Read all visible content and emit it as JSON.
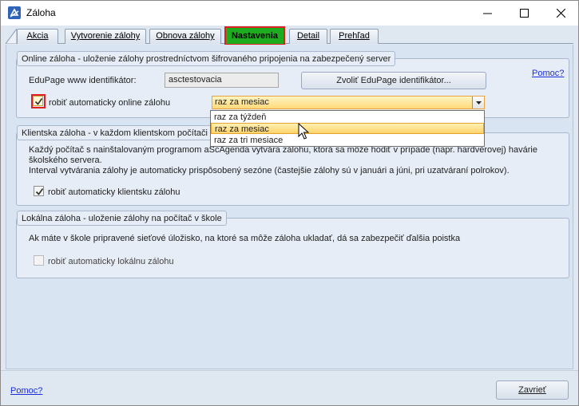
{
  "window": {
    "title": "Záloha",
    "controls": {
      "minimize": "minimize",
      "maximize": "maximize",
      "close": "close"
    }
  },
  "tabs": [
    {
      "label": "Akcia",
      "active": false
    },
    {
      "label": "Vytvorenie zálohy",
      "active": false
    },
    {
      "label": "Obnova zálohy",
      "active": false
    },
    {
      "label": "Nastavenia",
      "active": true
    },
    {
      "label": "Detail",
      "active": false
    },
    {
      "label": "Prehľad",
      "active": false
    }
  ],
  "online_group": {
    "title": "Online záloha - uloženie zálohy prostredníctvom šifrovaného pripojenia na zabezpečený server",
    "identifier_label": "EduPage www identifikátor:",
    "identifier_value": "asctestovacia",
    "choose_button": "Zvoliť EduPage identifikátor...",
    "help_link": "Pomoc?",
    "auto_checkbox_label": "robiť automaticky online zálohu",
    "auto_checked": true,
    "frequency_selected": "raz za mesiac",
    "frequency_options": [
      "raz za týždeň",
      "raz za mesiac",
      "raz za tri mesiace"
    ]
  },
  "client_group": {
    "title": "Klientska záloha - v každom klientskom počítači a",
    "line1": "Každý počítač s nainštalovaným programom aScAgenda vytvára zálohu, ktorá sa môže hodiť v prípade (napr. hardvérovej) havárie",
    "line2": "školského servera.",
    "line3": "Interval vytvárania zálohy je automaticky prispôsobený sezóne (častejšie zálohy sú v januári a júni, pri uzatváraní polrokov).",
    "auto_checkbox_label": "robiť automaticky klientsku zálohu",
    "auto_checked": true
  },
  "local_group": {
    "title": "Lokálna záloha - uloženie zálohy na počítač v škole",
    "description": "Ak máte v škole pripravené sieťové úložisko, na ktoré sa môže záloha ukladať, dá sa zabezpečiť ďalšia poistka",
    "auto_checkbox_label": "robiť automaticky lokálnu zálohu",
    "auto_checked": false
  },
  "footer": {
    "help_link": "Pomoc?",
    "close_button": "Zavrieť"
  },
  "colors": {
    "highlight": "#e02020",
    "active_tab": "#1eab1e",
    "combo_fill": "#ffd979",
    "link": "#1c2ed8"
  }
}
